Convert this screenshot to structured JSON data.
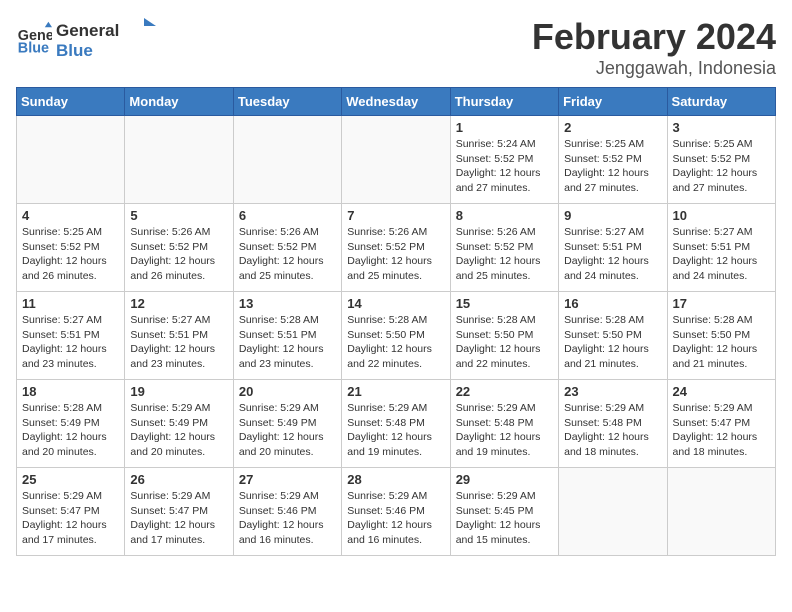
{
  "header": {
    "logo_line1": "General",
    "logo_line2": "Blue",
    "title": "February 2024",
    "subtitle": "Jenggawah, Indonesia"
  },
  "weekdays": [
    "Sunday",
    "Monday",
    "Tuesday",
    "Wednesday",
    "Thursday",
    "Friday",
    "Saturday"
  ],
  "weeks": [
    [
      {
        "day": "",
        "info": ""
      },
      {
        "day": "",
        "info": ""
      },
      {
        "day": "",
        "info": ""
      },
      {
        "day": "",
        "info": ""
      },
      {
        "day": "1",
        "info": "Sunrise: 5:24 AM\nSunset: 5:52 PM\nDaylight: 12 hours\nand 27 minutes."
      },
      {
        "day": "2",
        "info": "Sunrise: 5:25 AM\nSunset: 5:52 PM\nDaylight: 12 hours\nand 27 minutes."
      },
      {
        "day": "3",
        "info": "Sunrise: 5:25 AM\nSunset: 5:52 PM\nDaylight: 12 hours\nand 27 minutes."
      }
    ],
    [
      {
        "day": "4",
        "info": "Sunrise: 5:25 AM\nSunset: 5:52 PM\nDaylight: 12 hours\nand 26 minutes."
      },
      {
        "day": "5",
        "info": "Sunrise: 5:26 AM\nSunset: 5:52 PM\nDaylight: 12 hours\nand 26 minutes."
      },
      {
        "day": "6",
        "info": "Sunrise: 5:26 AM\nSunset: 5:52 PM\nDaylight: 12 hours\nand 25 minutes."
      },
      {
        "day": "7",
        "info": "Sunrise: 5:26 AM\nSunset: 5:52 PM\nDaylight: 12 hours\nand 25 minutes."
      },
      {
        "day": "8",
        "info": "Sunrise: 5:26 AM\nSunset: 5:52 PM\nDaylight: 12 hours\nand 25 minutes."
      },
      {
        "day": "9",
        "info": "Sunrise: 5:27 AM\nSunset: 5:51 PM\nDaylight: 12 hours\nand 24 minutes."
      },
      {
        "day": "10",
        "info": "Sunrise: 5:27 AM\nSunset: 5:51 PM\nDaylight: 12 hours\nand 24 minutes."
      }
    ],
    [
      {
        "day": "11",
        "info": "Sunrise: 5:27 AM\nSunset: 5:51 PM\nDaylight: 12 hours\nand 23 minutes."
      },
      {
        "day": "12",
        "info": "Sunrise: 5:27 AM\nSunset: 5:51 PM\nDaylight: 12 hours\nand 23 minutes."
      },
      {
        "day": "13",
        "info": "Sunrise: 5:28 AM\nSunset: 5:51 PM\nDaylight: 12 hours\nand 23 minutes."
      },
      {
        "day": "14",
        "info": "Sunrise: 5:28 AM\nSunset: 5:50 PM\nDaylight: 12 hours\nand 22 minutes."
      },
      {
        "day": "15",
        "info": "Sunrise: 5:28 AM\nSunset: 5:50 PM\nDaylight: 12 hours\nand 22 minutes."
      },
      {
        "day": "16",
        "info": "Sunrise: 5:28 AM\nSunset: 5:50 PM\nDaylight: 12 hours\nand 21 minutes."
      },
      {
        "day": "17",
        "info": "Sunrise: 5:28 AM\nSunset: 5:50 PM\nDaylight: 12 hours\nand 21 minutes."
      }
    ],
    [
      {
        "day": "18",
        "info": "Sunrise: 5:28 AM\nSunset: 5:49 PM\nDaylight: 12 hours\nand 20 minutes."
      },
      {
        "day": "19",
        "info": "Sunrise: 5:29 AM\nSunset: 5:49 PM\nDaylight: 12 hours\nand 20 minutes."
      },
      {
        "day": "20",
        "info": "Sunrise: 5:29 AM\nSunset: 5:49 PM\nDaylight: 12 hours\nand 20 minutes."
      },
      {
        "day": "21",
        "info": "Sunrise: 5:29 AM\nSunset: 5:48 PM\nDaylight: 12 hours\nand 19 minutes."
      },
      {
        "day": "22",
        "info": "Sunrise: 5:29 AM\nSunset: 5:48 PM\nDaylight: 12 hours\nand 19 minutes."
      },
      {
        "day": "23",
        "info": "Sunrise: 5:29 AM\nSunset: 5:48 PM\nDaylight: 12 hours\nand 18 minutes."
      },
      {
        "day": "24",
        "info": "Sunrise: 5:29 AM\nSunset: 5:47 PM\nDaylight: 12 hours\nand 18 minutes."
      }
    ],
    [
      {
        "day": "25",
        "info": "Sunrise: 5:29 AM\nSunset: 5:47 PM\nDaylight: 12 hours\nand 17 minutes."
      },
      {
        "day": "26",
        "info": "Sunrise: 5:29 AM\nSunset: 5:47 PM\nDaylight: 12 hours\nand 17 minutes."
      },
      {
        "day": "27",
        "info": "Sunrise: 5:29 AM\nSunset: 5:46 PM\nDaylight: 12 hours\nand 16 minutes."
      },
      {
        "day": "28",
        "info": "Sunrise: 5:29 AM\nSunset: 5:46 PM\nDaylight: 12 hours\nand 16 minutes."
      },
      {
        "day": "29",
        "info": "Sunrise: 5:29 AM\nSunset: 5:45 PM\nDaylight: 12 hours\nand 15 minutes."
      },
      {
        "day": "",
        "info": ""
      },
      {
        "day": "",
        "info": ""
      }
    ]
  ]
}
